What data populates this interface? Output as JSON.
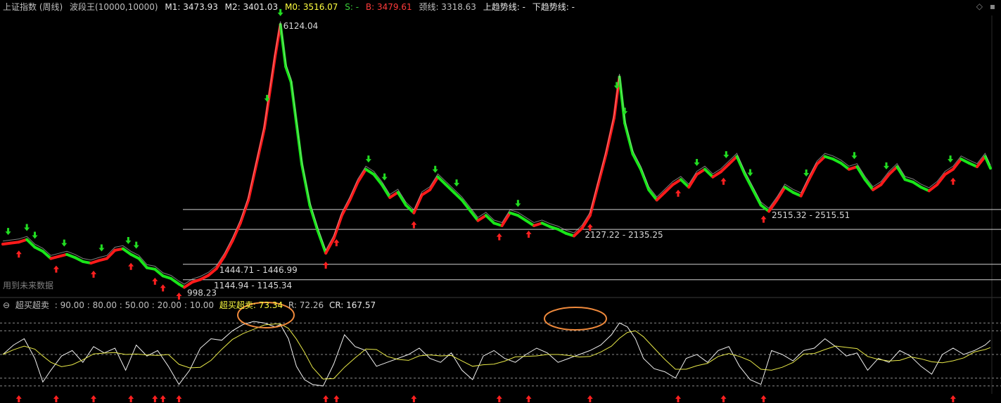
{
  "header": {
    "title": "上证指数 (周线)",
    "indicator_name": "波段王(10000,10000)",
    "m1": "M1: 3473.93",
    "m2": "M2: 3401.03",
    "m0": "M0: 3516.07",
    "s": "S: -",
    "b": "B: 3479.61",
    "neckline": "颈线: 3318.63",
    "uptrend": "上趋势线: -",
    "downtrend": "下趋势线: -"
  },
  "future_data_note": "用到未来数据",
  "sub_header": {
    "name": "超买超卖",
    "levels": ": 90.00 : 80.00 : 50.00 : 20.00 : 10.00",
    "value": "超买超卖: 73.34",
    "r": "R: 72.26",
    "cr": "CR: 167.57"
  },
  "colors": {
    "background": "#000000",
    "up_trend": "#ff1a1a",
    "down_trend": "#19e619",
    "signal_buy": "#ff2020",
    "signal_sell": "#22dd22",
    "osc_white": "#f0f0f0",
    "osc_yellow": "#e8e848",
    "highlight": "#f08a3c"
  },
  "chart_data": {
    "type": "line",
    "title": "上证指数 (周线)",
    "ylim": [
      950,
      6300
    ],
    "series": [
      {
        "name": "上证指数",
        "points": [
          [
            0,
            1840
          ],
          [
            3,
            1860
          ],
          [
            6,
            1880
          ],
          [
            9,
            1930
          ],
          [
            12,
            1780
          ],
          [
            15,
            1700
          ],
          [
            18,
            1560
          ],
          [
            21,
            1600
          ],
          [
            24,
            1640
          ],
          [
            27,
            1580
          ],
          [
            30,
            1500
          ],
          [
            33,
            1470
          ],
          [
            36,
            1520
          ],
          [
            39,
            1560
          ],
          [
            42,
            1720
          ],
          [
            45,
            1750
          ],
          [
            48,
            1640
          ],
          [
            51,
            1560
          ],
          [
            54,
            1380
          ],
          [
            57,
            1350
          ],
          [
            60,
            1220
          ],
          [
            63,
            1170
          ],
          [
            66,
            1060
          ],
          [
            68,
            998
          ],
          [
            71,
            1100
          ],
          [
            74,
            1150
          ],
          [
            77,
            1230
          ],
          [
            80,
            1360
          ],
          [
            83,
            1600
          ],
          [
            86,
            1900
          ],
          [
            89,
            2250
          ],
          [
            92,
            2700
          ],
          [
            95,
            3400
          ],
          [
            98,
            4100
          ],
          [
            100,
            4800
          ],
          [
            102,
            5500
          ],
          [
            104,
            6124
          ],
          [
            106,
            5300
          ],
          [
            108,
            5000
          ],
          [
            110,
            4200
          ],
          [
            112,
            3400
          ],
          [
            115,
            2600
          ],
          [
            118,
            2100
          ],
          [
            121,
            1664
          ],
          [
            124,
            1950
          ],
          [
            127,
            2400
          ],
          [
            130,
            2700
          ],
          [
            133,
            3050
          ],
          [
            136,
            3300
          ],
          [
            139,
            3200
          ],
          [
            142,
            3000
          ],
          [
            145,
            2750
          ],
          [
            148,
            2850
          ],
          [
            151,
            2600
          ],
          [
            154,
            2450
          ],
          [
            157,
            2800
          ],
          [
            160,
            2900
          ],
          [
            163,
            3150
          ],
          [
            166,
            3000
          ],
          [
            169,
            2850
          ],
          [
            172,
            2700
          ],
          [
            175,
            2500
          ],
          [
            178,
            2300
          ],
          [
            181,
            2400
          ],
          [
            184,
            2250
          ],
          [
            187,
            2200
          ],
          [
            190,
            2450
          ],
          [
            193,
            2400
          ],
          [
            196,
            2300
          ],
          [
            199,
            2200
          ],
          [
            202,
            2250
          ],
          [
            205,
            2180
          ],
          [
            208,
            2130
          ],
          [
            211,
            2050
          ],
          [
            214,
            2000
          ],
          [
            217,
            2150
          ],
          [
            220,
            2400
          ],
          [
            223,
            3000
          ],
          [
            226,
            3600
          ],
          [
            229,
            4300
          ],
          [
            231,
            5100
          ],
          [
            233,
            4200
          ],
          [
            236,
            3600
          ],
          [
            239,
            3300
          ],
          [
            242,
            2900
          ],
          [
            245,
            2700
          ],
          [
            248,
            2850
          ],
          [
            251,
            3000
          ],
          [
            254,
            3100
          ],
          [
            257,
            2950
          ],
          [
            260,
            3200
          ],
          [
            263,
            3300
          ],
          [
            266,
            3150
          ],
          [
            269,
            3250
          ],
          [
            272,
            3400
          ],
          [
            275,
            3550
          ],
          [
            278,
            3200
          ],
          [
            281,
            2900
          ],
          [
            284,
            2600
          ],
          [
            287,
            2480
          ],
          [
            290,
            2700
          ],
          [
            293,
            2950
          ],
          [
            296,
            2850
          ],
          [
            299,
            2780
          ],
          [
            302,
            3100
          ],
          [
            305,
            3400
          ],
          [
            308,
            3550
          ],
          [
            311,
            3500
          ],
          [
            314,
            3420
          ],
          [
            317,
            3300
          ],
          [
            320,
            3350
          ],
          [
            323,
            3100
          ],
          [
            326,
            2900
          ],
          [
            329,
            3000
          ],
          [
            332,
            3200
          ],
          [
            335,
            3350
          ],
          [
            338,
            3100
          ],
          [
            341,
            3050
          ],
          [
            344,
            2950
          ],
          [
            347,
            2880
          ],
          [
            350,
            3000
          ],
          [
            353,
            3200
          ],
          [
            356,
            3300
          ],
          [
            359,
            3500
          ],
          [
            362,
            3420
          ],
          [
            365,
            3350
          ],
          [
            368,
            3550
          ],
          [
            370,
            3320
          ]
        ]
      },
      {
        "name": "超买超卖",
        "points": [
          [
            0,
            50
          ],
          [
            4,
            62
          ],
          [
            8,
            70
          ],
          [
            12,
            45
          ],
          [
            15,
            15
          ],
          [
            18,
            30
          ],
          [
            22,
            48
          ],
          [
            26,
            55
          ],
          [
            30,
            40
          ],
          [
            34,
            60
          ],
          [
            38,
            52
          ],
          [
            42,
            58
          ],
          [
            46,
            30
          ],
          [
            50,
            62
          ],
          [
            54,
            48
          ],
          [
            58,
            55
          ],
          [
            62,
            35
          ],
          [
            66,
            12
          ],
          [
            70,
            30
          ],
          [
            74,
            58
          ],
          [
            78,
            70
          ],
          [
            82,
            68
          ],
          [
            86,
            80
          ],
          [
            90,
            88
          ],
          [
            94,
            92
          ],
          [
            98,
            90
          ],
          [
            102,
            85
          ],
          [
            104,
            88
          ],
          [
            107,
            70
          ],
          [
            110,
            35
          ],
          [
            113,
            18
          ],
          [
            116,
            12
          ],
          [
            120,
            10
          ],
          [
            124,
            38
          ],
          [
            128,
            75
          ],
          [
            132,
            60
          ],
          [
            136,
            55
          ],
          [
            140,
            35
          ],
          [
            144,
            40
          ],
          [
            148,
            45
          ],
          [
            152,
            50
          ],
          [
            156,
            58
          ],
          [
            160,
            45
          ],
          [
            164,
            40
          ],
          [
            168,
            52
          ],
          [
            172,
            30
          ],
          [
            176,
            18
          ],
          [
            180,
            48
          ],
          [
            184,
            55
          ],
          [
            188,
            45
          ],
          [
            192,
            40
          ],
          [
            196,
            50
          ],
          [
            200,
            58
          ],
          [
            204,
            52
          ],
          [
            208,
            40
          ],
          [
            212,
            45
          ],
          [
            216,
            50
          ],
          [
            220,
            55
          ],
          [
            224,
            62
          ],
          [
            228,
            75
          ],
          [
            231,
            90
          ],
          [
            234,
            85
          ],
          [
            237,
            70
          ],
          [
            240,
            45
          ],
          [
            244,
            32
          ],
          [
            248,
            28
          ],
          [
            252,
            20
          ],
          [
            256,
            45
          ],
          [
            260,
            50
          ],
          [
            264,
            40
          ],
          [
            268,
            55
          ],
          [
            272,
            60
          ],
          [
            276,
            35
          ],
          [
            280,
            18
          ],
          [
            284,
            12
          ],
          [
            288,
            55
          ],
          [
            292,
            50
          ],
          [
            296,
            42
          ],
          [
            300,
            55
          ],
          [
            304,
            58
          ],
          [
            308,
            70
          ],
          [
            312,
            60
          ],
          [
            316,
            48
          ],
          [
            320,
            52
          ],
          [
            324,
            30
          ],
          [
            328,
            45
          ],
          [
            332,
            40
          ],
          [
            336,
            55
          ],
          [
            340,
            48
          ],
          [
            344,
            35
          ],
          [
            348,
            25
          ],
          [
            352,
            50
          ],
          [
            356,
            58
          ],
          [
            360,
            50
          ],
          [
            364,
            55
          ],
          [
            368,
            62
          ],
          [
            370,
            68
          ]
        ]
      }
    ],
    "annotations": [
      {
        "x": 104,
        "y": 6124.04,
        "text": "6124.04"
      },
      {
        "x": 68,
        "y": 998.23,
        "text": "998.23"
      },
      {
        "x": 78,
        "y": 1144.94,
        "text": "1144.94 - 1145.34"
      },
      {
        "x": 80,
        "y": 1444.71,
        "text": "1444.71 - 1446.99"
      },
      {
        "x": 217,
        "y": 2127.22,
        "text": "2127.22 - 2135.25"
      },
      {
        "x": 287,
        "y": 2515.32,
        "text": "2515.32 - 2515.51"
      }
    ],
    "horizontal_levels": [
      1145.34,
      1446.99,
      2127.22,
      2515.51
    ],
    "oscillator_levels": [
      90,
      80,
      50,
      20,
      10
    ],
    "buy_signals_x": [
      6,
      20,
      34,
      48,
      57,
      60,
      66,
      121,
      125,
      154,
      186,
      197,
      220,
      253,
      270,
      285,
      356
    ],
    "sell_signals_x": [
      2,
      9,
      12,
      23,
      37,
      47,
      50,
      99,
      104,
      137,
      143,
      162,
      170,
      193,
      230,
      233,
      260,
      271,
      280,
      301,
      319,
      331,
      355
    ]
  }
}
